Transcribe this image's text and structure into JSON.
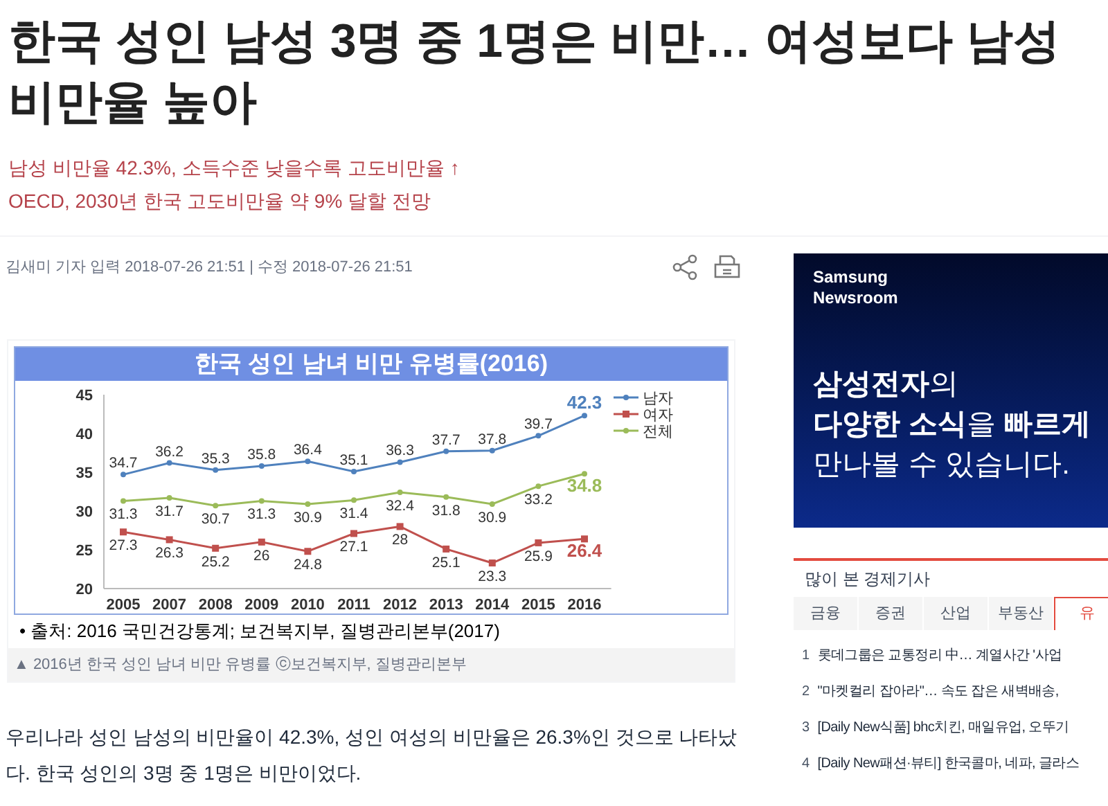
{
  "headline_lines": [
    "한국 성인 남성 3명 중 1명은 비만… 여성보다 남성",
    "비만율 높아"
  ],
  "subheads": [
    "남성 비만율 42.3%, 소득수준 낮을수록 고도비만율 ↑",
    "OECD, 2030년 한국 고도비만율 약 9% 달할 전망"
  ],
  "byline": "김새미 기자 입력 2018-07-26 21:51 | 수정 2018-07-26 21:51",
  "figure": {
    "chart_data": {
      "type": "line",
      "title": "한국 성인 남녀 비만 유병률(2016)",
      "categories": [
        "2005",
        "2007",
        "2008",
        "2009",
        "2010",
        "2011",
        "2012",
        "2013",
        "2014",
        "2015",
        "2016"
      ],
      "yticks": [
        20,
        25,
        30,
        35,
        40,
        45
      ],
      "ylim": [
        20,
        45
      ],
      "data_labels": true,
      "legend": true,
      "series": [
        {
          "name": "남자",
          "color": "#4f81bd",
          "marker": "circle",
          "values": [
            34.7,
            36.2,
            35.3,
            35.8,
            36.4,
            35.1,
            36.3,
            37.7,
            37.8,
            39.7,
            42.3
          ]
        },
        {
          "name": "여자",
          "color": "#c0504d",
          "marker": "square",
          "values": [
            27.3,
            26.3,
            25.2,
            26,
            24.8,
            27.1,
            28,
            25.1,
            23.3,
            25.9,
            26.4
          ]
        },
        {
          "name": "전체",
          "color": "#9bbb59",
          "marker": "circle",
          "values": [
            31.3,
            31.7,
            30.7,
            31.3,
            30.9,
            31.4,
            32.4,
            31.8,
            30.9,
            33.2,
            34.8
          ]
        }
      ]
    },
    "source": "• 출처: 2016 국민건강통계; 보건복지부, 질병관리본부(2017)",
    "caption": "▲ 2016년 한국 성인 남녀 비만 유병률 ⓒ보건복지부, 질병관리본부"
  },
  "body": "우리나라 성인 남성의 비만율이 42.3%, 성인 여성의 비만율은 26.3%인 것으로 나타났다. 한국 성인의 3명 중 1명은 비만이었다.",
  "ad": {
    "brand_lines": [
      "Samsung",
      "Newsroom"
    ],
    "lines": [
      "**삼성전자**의",
      "**다양한 소식**을 **빠르게**",
      "만나볼 수 있습니다."
    ]
  },
  "most_read": {
    "title": "많이 본 경제기사",
    "tabs": [
      {
        "label": "금융",
        "selected": false
      },
      {
        "label": "증권",
        "selected": false
      },
      {
        "label": "산업",
        "selected": false
      },
      {
        "label": "부동산",
        "selected": false
      },
      {
        "label": "유",
        "selected": true
      }
    ],
    "items": [
      {
        "rank": "1",
        "title": "롯데그룹은 교통정리 中… 계열사간 '사업"
      },
      {
        "rank": "2",
        "title": "\"마켓컬리 잡아라\"… 속도 잡은 새벽배송,"
      },
      {
        "rank": "3",
        "title": "[Daily New식품] bhc치킨, 매일유업, 오뚜기"
      },
      {
        "rank": "4",
        "title": "[Daily New패션·뷰티] 한국콜마, 네파, 글라스"
      }
    ]
  }
}
